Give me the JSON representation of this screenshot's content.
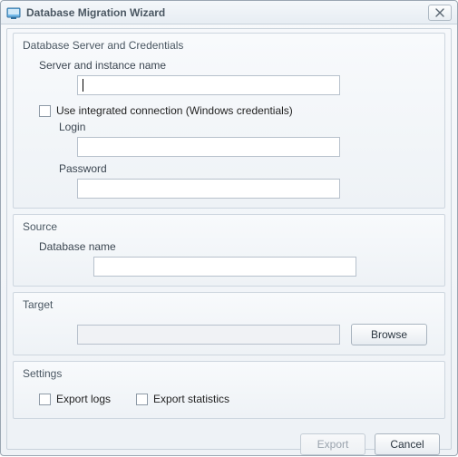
{
  "window": {
    "title": "Database Migration Wizard"
  },
  "groups": {
    "credentials": {
      "title": "Database Server and Credentials",
      "server_label": "Server and instance name",
      "server_value": "",
      "integrated_label": "Use integrated connection (Windows credentials)",
      "integrated_checked": false,
      "login_label": "Login",
      "login_value": "",
      "password_label": "Password",
      "password_value": ""
    },
    "source": {
      "title": "Source",
      "dbname_label": "Database name",
      "dbname_value": ""
    },
    "target": {
      "title": "Target",
      "path_value": "",
      "browse_label": "Browse"
    },
    "settings": {
      "title": "Settings",
      "export_logs_label": "Export logs",
      "export_logs_checked": false,
      "export_stats_label": "Export statistics",
      "export_stats_checked": false
    }
  },
  "buttons": {
    "export": "Export",
    "cancel": "Cancel"
  }
}
